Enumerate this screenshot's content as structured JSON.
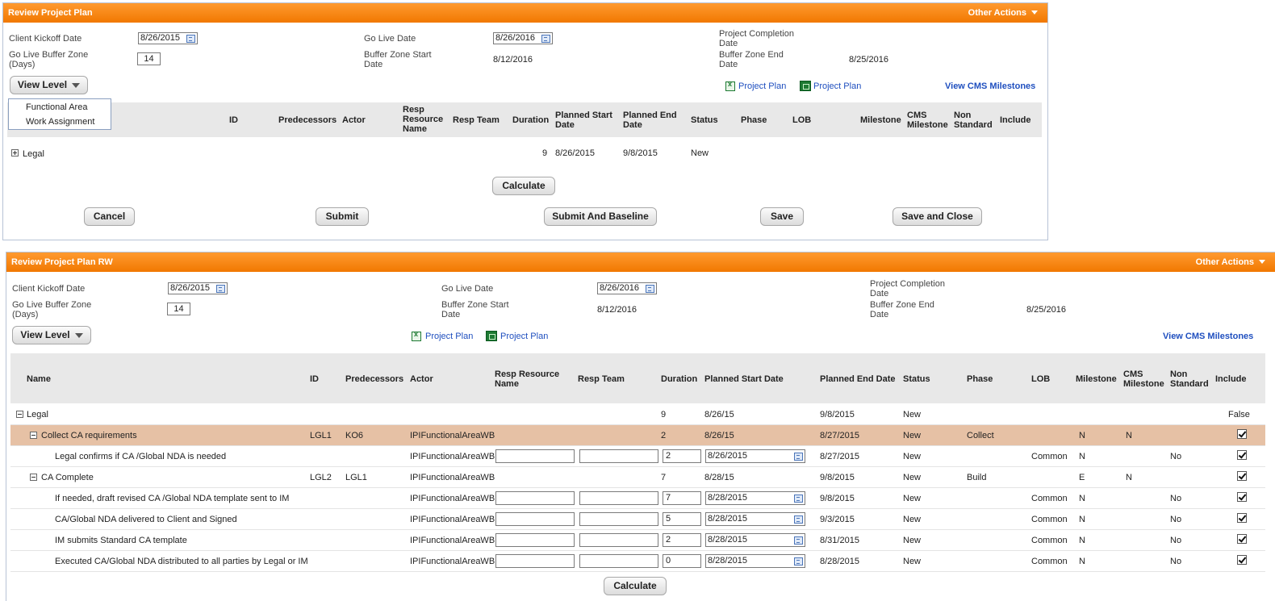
{
  "panel1": {
    "title": "Review Project Plan",
    "other_actions": "Other Actions",
    "client_kickoff_label": "Client Kickoff Date",
    "client_kickoff_value": "8/26/2015",
    "go_live_label": "Go Live Date",
    "go_live_value": "8/26/2016",
    "project_completion_label_1": "Project Completion",
    "project_completion_label_2": "Date",
    "buffer_zone_label_1": "Go Live Buffer Zone",
    "buffer_zone_label_2": "(Days)",
    "buffer_zone_value": "14",
    "buffer_start_label_1": "Buffer Zone Start",
    "buffer_start_label_2": "Date",
    "buffer_start_value": "8/12/2016",
    "buffer_end_label_1": "Buffer Zone End",
    "buffer_end_label_2": "Date",
    "buffer_end_value": "8/25/2016",
    "view_level": "View Level",
    "dropdown_items": [
      "Functional Area",
      "Work Assignment"
    ],
    "project_plan_excel": "Project Plan",
    "project_plan_project": "Project Plan",
    "view_cms": "View CMS Milestones",
    "headers": {
      "id": "ID",
      "predecessors": "Predecessors",
      "actor": "Actor",
      "resp_resource_1": "Resp",
      "resp_resource_2": "Resource",
      "resp_resource_3": "Name",
      "resp_team": "Resp Team",
      "duration": "Duration",
      "planned_start_1": "Planned Start",
      "planned_start_2": "Date",
      "planned_end_1": "Planned End",
      "planned_end_2": "Date",
      "status": "Status",
      "phase": "Phase",
      "lob": "LOB",
      "milestone": "Milestone",
      "cms_1": "CMS",
      "cms_2": "Milestone",
      "non_std_1": "Non",
      "non_std_2": "Standard",
      "include": "Include"
    },
    "row": {
      "name": "Legal",
      "duration": "9",
      "start": "8/26/2015",
      "end": "9/8/2015",
      "status": "New"
    },
    "calculate": "Calculate",
    "buttons": {
      "cancel": "Cancel",
      "submit": "Submit",
      "submit_baseline": "Submit And Baseline",
      "save": "Save",
      "save_close": "Save and Close"
    }
  },
  "panel2": {
    "title": "Review Project Plan RW",
    "other_actions": "Other Actions",
    "client_kickoff_label": "Client Kickoff Date",
    "client_kickoff_value": "8/26/2015",
    "go_live_label": "Go Live Date",
    "go_live_value": "8/26/2016",
    "project_completion_label_1": "Project Completion",
    "project_completion_label_2": "Date",
    "buffer_zone_label_1": "Go Live Buffer Zone",
    "buffer_zone_label_2": "(Days)",
    "buffer_zone_value": "14",
    "buffer_start_label_1": "Buffer Zone Start",
    "buffer_start_label_2": "Date",
    "buffer_start_value": "8/12/2016",
    "buffer_end_label_1": "Buffer Zone End",
    "buffer_end_label_2": "Date",
    "buffer_end_value": "8/25/2016",
    "view_level": "View Level",
    "project_plan_excel": "Project Plan",
    "project_plan_project": "Project Plan",
    "view_cms": "View CMS Milestones",
    "headers": {
      "name": "Name",
      "id": "ID",
      "predecessors": "Predecessors",
      "actor": "Actor",
      "resp_resource_1": "Resp Resource",
      "resp_resource_2": "Name",
      "resp_team": "Resp Team",
      "duration": "Duration",
      "planned_start": "Planned Start Date",
      "planned_end": "Planned End Date",
      "status": "Status",
      "phase": "Phase",
      "lob": "LOB",
      "milestone": "Milestone",
      "cms_1": "CMS",
      "cms_2": "Milestone",
      "non_std_1": "Non",
      "non_std_2": "Standard",
      "include": "Include"
    },
    "rows": [
      {
        "name": "Legal",
        "id": "",
        "pred": "",
        "actor": "",
        "duration": "9",
        "start": "8/26/15",
        "end": "9/8/2015",
        "status": "New",
        "phase": "",
        "lob": "",
        "milestone": "",
        "cms": "",
        "nonstd": "",
        "include": "False"
      },
      {
        "name": "Collect CA requirements",
        "id": "LGL1",
        "pred": "KO6",
        "actor": "IPIFunctionalAreaWB",
        "duration": "2",
        "start": "8/26/15",
        "end": "8/27/2015",
        "status": "New",
        "phase": "Collect",
        "lob": "",
        "milestone": "N",
        "cms": "N",
        "nonstd": "",
        "include": ""
      },
      {
        "name": "Legal confirms if CA /Global NDA is needed",
        "id": "",
        "pred": "",
        "actor": "IPIFunctionalAreaWB",
        "duration": "2",
        "start": "8/26/2015",
        "end": "8/27/2015",
        "status": "New",
        "phase": "",
        "lob": "Common",
        "milestone": "N",
        "cms": "",
        "nonstd": "No",
        "include": ""
      },
      {
        "name": "CA Complete",
        "id": "LGL2",
        "pred": "LGL1",
        "actor": "IPIFunctionalAreaWB",
        "duration": "7",
        "start": "8/28/15",
        "end": "9/8/2015",
        "status": "New",
        "phase": "Build",
        "lob": "",
        "milestone": "E",
        "cms": "N",
        "nonstd": "",
        "include": ""
      },
      {
        "name": "If needed, draft revised CA /Global NDA template sent to IM",
        "id": "",
        "pred": "",
        "actor": "IPIFunctionalAreaWB",
        "duration": "7",
        "start": "8/28/2015",
        "end": "9/8/2015",
        "status": "New",
        "phase": "",
        "lob": "Common",
        "milestone": "N",
        "cms": "",
        "nonstd": "No",
        "include": ""
      },
      {
        "name": "CA/Global NDA delivered to Client and Signed",
        "id": "",
        "pred": "",
        "actor": "IPIFunctionalAreaWB",
        "duration": "5",
        "start": "8/28/2015",
        "end": "9/3/2015",
        "status": "New",
        "phase": "",
        "lob": "Common",
        "milestone": "N",
        "cms": "",
        "nonstd": "No",
        "include": ""
      },
      {
        "name": "IM submits Standard CA template",
        "id": "",
        "pred": "",
        "actor": "IPIFunctionalAreaWB",
        "duration": "2",
        "start": "8/28/2015",
        "end": "8/31/2015",
        "status": "New",
        "phase": "",
        "lob": "Common",
        "milestone": "N",
        "cms": "",
        "nonstd": "No",
        "include": ""
      },
      {
        "name": "Executed CA/Global NDA distributed to all parties by Legal or IM",
        "id": "",
        "pred": "",
        "actor": "IPIFunctionalAreaWB",
        "duration": "0",
        "start": "8/28/2015",
        "end": "8/28/2015",
        "status": "New",
        "phase": "",
        "lob": "Common",
        "milestone": "N",
        "cms": "",
        "nonstd": "No",
        "include": ""
      }
    ],
    "calculate": "Calculate"
  }
}
